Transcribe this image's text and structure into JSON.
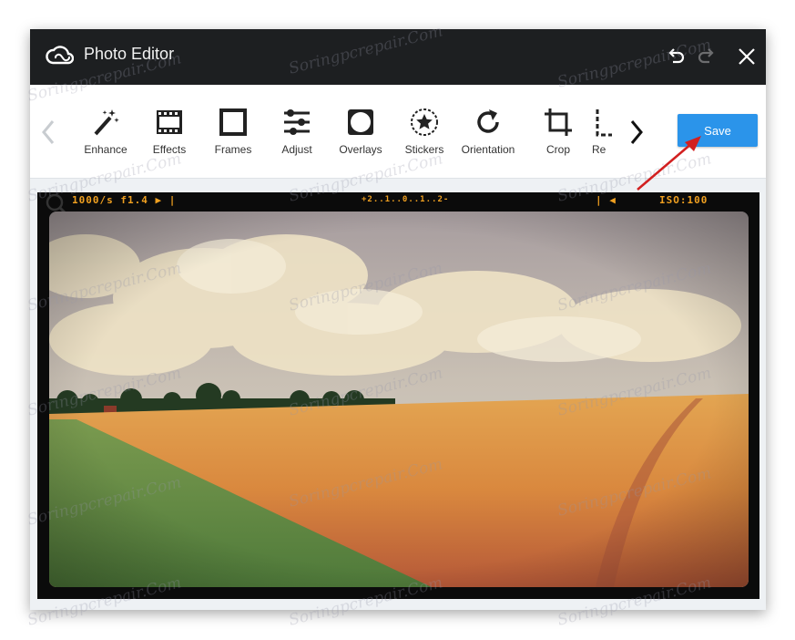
{
  "app": {
    "title": "Photo Editor",
    "logo_icon": "creative-cloud-icon"
  },
  "titlebar": {
    "undo_icon": "undo-icon",
    "redo_icon": "redo-icon",
    "close_icon": "close-icon"
  },
  "toolbar": {
    "tools": [
      {
        "label": "Enhance",
        "icon": "magic-wand-icon"
      },
      {
        "label": "Effects",
        "icon": "film-strip-icon"
      },
      {
        "label": "Frames",
        "icon": "frame-icon"
      },
      {
        "label": "Adjust",
        "icon": "sliders-icon"
      },
      {
        "label": "Overlays",
        "icon": "overlay-icon"
      },
      {
        "label": "Stickers",
        "icon": "star-sticker-icon"
      },
      {
        "label": "Orientation",
        "icon": "rotate-icon"
      },
      {
        "label": "Crop",
        "icon": "crop-icon"
      },
      {
        "label": "Re",
        "icon": "resize-icon"
      }
    ],
    "save_label": "Save"
  },
  "film_frame": {
    "exposure": "1000/s f1.4  ▶ |",
    "scale": "+2..1..0..1..2-",
    "marker": "| ◀",
    "iso": "ISO:100"
  },
  "watermark_text": "Soringpcrepair.Com",
  "colors": {
    "titlebar": "#1d1f21",
    "save_button": "#2b94ea",
    "annotation_arrow": "#d22020",
    "film_text": "#f0a020"
  }
}
